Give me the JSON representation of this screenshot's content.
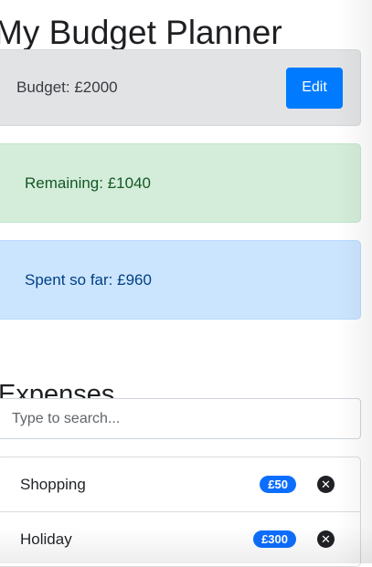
{
  "page": {
    "title": "My Budget Planner"
  },
  "budget": {
    "label": "Budget: £2000",
    "edit_label": "Edit"
  },
  "remaining": {
    "label": "Remaining: £1040"
  },
  "spent": {
    "label": "Spent so far: £960"
  },
  "expenses": {
    "title": "Expenses",
    "search_placeholder": "Type to search...",
    "items": [
      {
        "name": "Shopping",
        "cost": "£50",
        "delete_icon": "close-circle-icon"
      },
      {
        "name": "Holiday",
        "cost": "£300",
        "delete_icon": "close-circle-icon"
      }
    ]
  },
  "colors": {
    "primary": "#007bff",
    "badge": "#0d6efd",
    "success_bg": "#d4edda",
    "info_bg": "#cce5ff",
    "secondary_bg": "#e2e3e5"
  }
}
